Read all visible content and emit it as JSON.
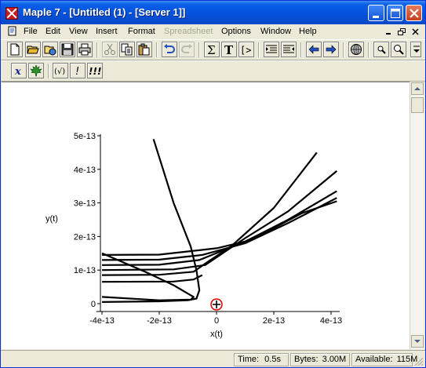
{
  "window": {
    "title": "Maple 7  - [Untitled (1) - [Server 1]]"
  },
  "menubar": {
    "items": [
      "File",
      "Edit",
      "View",
      "Insert",
      "Format",
      "Spreadsheet",
      "Options",
      "Window",
      "Help"
    ],
    "disabled": [
      "Spreadsheet"
    ]
  },
  "toolbar1": {
    "buttons": [
      "new-document",
      "open",
      "open-url",
      "save",
      "print",
      "cut",
      "copy",
      "paste",
      "undo",
      "redo",
      "sum",
      "text",
      "input-prompt",
      "collapse-section",
      "expand-section",
      "back",
      "forward",
      "stop",
      "zoom-in",
      "zoom-out"
    ]
  },
  "toolbar2": {
    "buttons": [
      "math-mode",
      "maple-leaf",
      "evaluate",
      "execute",
      "execute-all"
    ],
    "labels": {
      "math": "x",
      "eval": "(√)",
      "exec": "!",
      "execall": "!!!",
      "sum": "Σ",
      "text": "T",
      "prompt": "[>"
    }
  },
  "chart_data": {
    "type": "line",
    "xlabel": "x(t)",
    "ylabel": "y(t)",
    "xlim": [
      -4.2e-13,
      4.5e-13
    ],
    "ylim": [
      -2e-14,
      5.1e-13
    ],
    "x_ticks": [
      -4e-13,
      -2e-13,
      0,
      2e-13,
      4e-13
    ],
    "x_tick_labels": [
      "-4e-13",
      "-2e-13",
      "0",
      "2e-13",
      "4e-13"
    ],
    "y_ticks": [
      0,
      1e-13,
      2e-13,
      3e-13,
      4e-13,
      5e-13
    ],
    "y_tick_labels": [
      "0",
      "1e-13",
      "2e-13",
      "3e-13",
      "4e-13",
      "5e-13"
    ],
    "series": [
      {
        "points": [
          [
            -4e-13,
            1.45e-13
          ],
          [
            -2e-13,
            1.46e-13
          ],
          [
            0,
            1.65e-13
          ],
          [
            1e-13,
            1.85e-13
          ],
          [
            2e-13,
            2.25e-13
          ],
          [
            3e-13,
            2.7e-13
          ],
          [
            4.2e-13,
            3.05e-13
          ]
        ]
      },
      {
        "points": [
          [
            -4e-13,
            1.3e-13
          ],
          [
            -2e-13,
            1.31e-13
          ],
          [
            -5e-14,
            1.45e-13
          ],
          [
            1e-13,
            1.8e-13
          ],
          [
            2.5e-13,
            2.4e-13
          ],
          [
            4.2e-13,
            3.15e-13
          ]
        ]
      },
      {
        "points": [
          [
            -4e-13,
            1.15e-13
          ],
          [
            -2e-13,
            1.16e-13
          ],
          [
            -6e-14,
            1.3e-13
          ],
          [
            1e-13,
            1.85e-13
          ],
          [
            2.5e-13,
            2.5e-13
          ],
          [
            4.2e-13,
            3.35e-13
          ]
        ]
      },
      {
        "points": [
          [
            -4e-13,
            1e-13
          ],
          [
            -1.5e-13,
            1.02e-13
          ],
          [
            -4e-14,
            1.15e-13
          ],
          [
            1e-13,
            1.95e-13
          ],
          [
            2.5e-13,
            2.75e-13
          ],
          [
            4.2e-13,
            3.95e-13
          ]
        ]
      },
      {
        "points": [
          [
            -4e-13,
            8.5e-14
          ],
          [
            -2e-13,
            8.6e-14
          ],
          [
            -8e-14,
            9.5e-14
          ],
          [
            -3e-14,
            1.25e-13
          ],
          [
            5e-14,
            1.7e-13
          ],
          [
            2e-13,
            2.85e-13
          ],
          [
            3.5e-13,
            4.5e-13
          ]
        ]
      },
      {
        "points": [
          [
            -4e-13,
            6.5e-14
          ],
          [
            -1.5e-13,
            6.6e-14
          ],
          [
            -8e-14,
            7.2e-14
          ],
          [
            -5e-14,
            8.5e-14
          ]
        ]
      },
      {
        "points": [
          [
            -4e-13,
            5e-15
          ],
          [
            -2e-13,
            7e-15
          ],
          [
            -1e-13,
            1e-14
          ],
          [
            -7e-14,
            1.5e-14
          ],
          [
            -6e-14,
            4e-14
          ],
          [
            -7e-14,
            1e-13
          ],
          [
            -9e-14,
            1.7e-13
          ],
          [
            -1.5e-13,
            3e-13
          ],
          [
            -2.2e-13,
            4.9e-13
          ]
        ]
      },
      {
        "points": [
          [
            -4e-13,
            1.5e-13
          ],
          [
            -2.5e-13,
            9.5e-14
          ],
          [
            -1.5e-13,
            5.5e-14
          ],
          [
            -1e-13,
            3e-14
          ],
          [
            -8e-14,
            2e-14
          ],
          [
            -9e-14,
            1.2e-14
          ],
          [
            -2e-13,
            1e-14
          ],
          [
            -4e-13,
            2e-14
          ]
        ]
      }
    ]
  },
  "statusbar": {
    "time_label": "Time:",
    "time_value": "0.5s",
    "bytes_label": "Bytes:",
    "bytes_value": "3.00M",
    "available_label": "Available:",
    "available_value": "115M"
  },
  "colors": {
    "title_bar": "#0a5fe6",
    "close_button": "#c6401f",
    "plot_line": "#000000",
    "cursor_circle": "#e00000"
  }
}
